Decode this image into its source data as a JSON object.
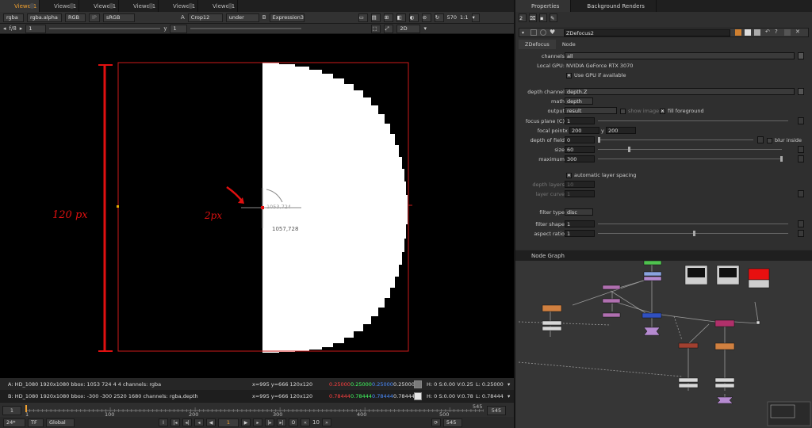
{
  "viewer_tabs": [
    "Viewer1",
    "Viewer1",
    "Viewer1",
    "Viewer1",
    "Viewer1",
    "Viewer1"
  ],
  "viewer_toolbar": {
    "layer": "rgba",
    "channel": "rgba.alpha",
    "display": "RGB",
    "ip": "IP",
    "colorspace": "sRGB",
    "input_a_label": "A",
    "input_a": "Crop12",
    "merge": "under",
    "input_b_label": "B",
    "input_b": "Expression3",
    "zoom_pct": "570",
    "ratio": "1:1"
  },
  "viewer_toolbar2": {
    "fstop": "f/8",
    "gain": "1",
    "gamma_label": "y",
    "gamma": "1",
    "view_mode": "2D"
  },
  "canvas_overlay": {
    "cursor_coord": "1053,724",
    "bbox_corner_label": "1057,728",
    "annotation_left": "120 px",
    "annotation_mid": "2px"
  },
  "info": {
    "a": {
      "label": "A:",
      "text": "HD_1080 1920x1080  bbox: 1053 724 4 4 channels: rgba",
      "xy": "x=995 y=666 120x120",
      "r": "0.25000",
      "g": "0.25000",
      "b": "0.25000",
      "a": "0.25000",
      "swatch": "#7a7a7a",
      "hsv": "H:  0 S:0.00 V:0.25",
      "lum": "L: 0.25000"
    },
    "b": {
      "label": "B:",
      "text": "HD_1080 1920x1080  bbox: -300 -300 2520 1680 channels: rgba,depth",
      "xy": "x=995 y=666 120x120",
      "r": "0.78444",
      "g": "0.78444",
      "b": "0.78444",
      "a": "0.78444",
      "swatch": "#e6e6e6",
      "hsv": "H:  0 S:0.00 V:0.78",
      "lum": "L: 0.78444"
    }
  },
  "timeline": {
    "start": "1",
    "end": "545",
    "end_right": "545",
    "ticks": [
      "1",
      "100",
      "200",
      "300",
      "400",
      "500",
      "545"
    ]
  },
  "playback": {
    "fps": "24*",
    "tf": "TF",
    "scope": "Global",
    "frame": "1",
    "increment": "10",
    "end": "545"
  },
  "right_tabs": [
    "Properties",
    "Background Renders"
  ],
  "properties": {
    "node_name": "ZDefocus2",
    "tabs": [
      "ZDefocus",
      "Node"
    ],
    "channels_label": "channels",
    "channels": "all",
    "local_gpu_label": "Local GPU:",
    "local_gpu": "NVIDIA GeForce RTX 3070",
    "use_gpu": "Use GPU if available",
    "depth_channel_label": "depth channel",
    "depth_channel": "depth.Z",
    "math_label": "math",
    "math": "depth",
    "output_label": "output",
    "output": "result",
    "show_image": "show image",
    "fill_foreground": "fill foreground",
    "focus_plane_label": "focus plane (C)",
    "focus_plane": "1",
    "focal_point_label": "focal point",
    "focal_x_label": "x",
    "focal_x": "200",
    "focal_y_label": "y",
    "focal_y": "200",
    "dof_label": "depth of field",
    "dof": "0",
    "blur_inside": "blur inside",
    "size_label": "size",
    "size": "60",
    "maximum_label": "maximum",
    "maximum": "300",
    "auto_layer": "automatic layer spacing",
    "depth_layers_label": "depth layers",
    "depth_layers": "10",
    "layer_curve_label": "layer curve",
    "layer_curve": "1",
    "filter_type_label": "filter type",
    "filter_type": "disc",
    "filter_shape_label": "filter shape",
    "filter_shape": "1",
    "aspect_ratio_label": "aspect ratio",
    "aspect_ratio": "1"
  },
  "node_graph_tab": "Node Graph",
  "colors": {
    "accent_orange": "#f0a030",
    "bbox_red": "#cc1a1a",
    "annotation_red": "#e01010"
  }
}
